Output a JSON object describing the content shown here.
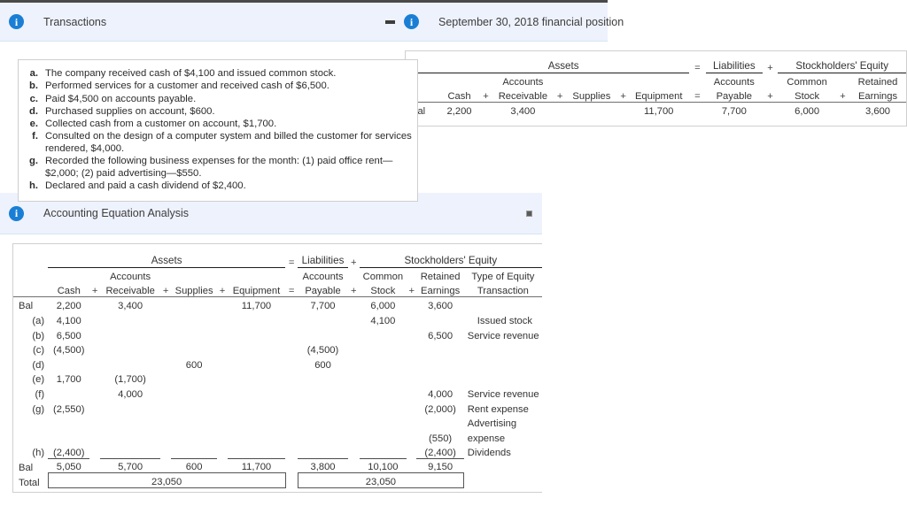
{
  "panels": {
    "transactions": {
      "title": "Transactions",
      "icon": "info-icon",
      "minimize_label": "—",
      "items": [
        {
          "letter": "a.",
          "text": "The company received cash of $4,100 and issued common stock."
        },
        {
          "letter": "b.",
          "text": "Performed services for a customer and received cash of $6,500."
        },
        {
          "letter": "c.",
          "text": "Paid $4,500 on accounts payable."
        },
        {
          "letter": "d.",
          "text": "Purchased supplies on account, $600."
        },
        {
          "letter": "e.",
          "text": "Collected cash from a customer on account, $1,700."
        },
        {
          "letter": "f.",
          "text": "Consulted on the design of a computer system and billed the customer for services rendered, $4,000."
        },
        {
          "letter": "g.",
          "text": "Recorded the following business expenses for the month: (1) paid office rent—$2,000; (2) paid advertising—$550."
        },
        {
          "letter": "h.",
          "text": "Declared and paid a cash dividend of $2,400."
        }
      ]
    },
    "financial_position": {
      "title": "September 30, 2018 financial position",
      "icon": "info-icon",
      "groups": {
        "assets": "Assets",
        "liabilities": "Liabilities",
        "equity": "Stockholders' Equity"
      },
      "operators": {
        "eq": "=",
        "plus": "+"
      },
      "columns": {
        "cash": {
          "line1": "",
          "line2": "Cash"
        },
        "receivable": {
          "line1": "Accounts",
          "line2": "Receivable"
        },
        "supplies": {
          "line1": "",
          "line2": "Supplies"
        },
        "equipment": {
          "line1": "",
          "line2": "Equipment"
        },
        "payable": {
          "line1": "Accounts",
          "line2": "Payable"
        },
        "stock": {
          "line1": "Common",
          "line2": "Stock"
        },
        "earnings": {
          "line1": "Retained",
          "line2": "Earnings"
        }
      },
      "row": {
        "label": "Bal",
        "cash": "2,200",
        "receivable": "3,400",
        "supplies": "",
        "equipment": "11,700",
        "payable": "7,700",
        "stock": "6,000",
        "earnings": "3,600"
      }
    },
    "accounting_equation": {
      "title": "Accounting Equation Analysis",
      "icon": "info-icon",
      "groups": {
        "assets": "Assets",
        "liabilities": "Liabilities",
        "equity": "Stockholders' Equity"
      },
      "operators": {
        "eq": "=",
        "plus": "+"
      },
      "columns": {
        "cash": {
          "line1": "",
          "line2": "Cash"
        },
        "receivable": {
          "line1": "Accounts",
          "line2": "Receivable"
        },
        "supplies": {
          "line1": "",
          "line2": "Supplies"
        },
        "equipment": {
          "line1": "",
          "line2": "Equipment"
        },
        "payable": {
          "line1": "Accounts",
          "line2": "Payable"
        },
        "stock": {
          "line1": "Common",
          "line2": "Stock"
        },
        "earnings": {
          "line1": "Retained",
          "line2": "Earnings"
        },
        "type": {
          "line1": "Type of Equity",
          "line2": "Transaction"
        }
      },
      "rows": [
        {
          "label": "Bal",
          "cash": "2,200",
          "receivable": "3,400",
          "supplies": "",
          "equipment": "11,700",
          "payable": "7,700",
          "stock": "6,000",
          "earnings": "3,600",
          "type": ""
        },
        {
          "label": "(a)",
          "cash": "4,100",
          "receivable": "",
          "supplies": "",
          "equipment": "",
          "payable": "",
          "stock": "4,100",
          "earnings": "",
          "type": "Issued stock"
        },
        {
          "label": "(b)",
          "cash": "6,500",
          "receivable": "",
          "supplies": "",
          "equipment": "",
          "payable": "",
          "stock": "",
          "earnings": "6,500",
          "type": "Service revenue"
        },
        {
          "label": "(c)",
          "cash": "(4,500)",
          "receivable": "",
          "supplies": "",
          "equipment": "",
          "payable": "(4,500)",
          "stock": "",
          "earnings": "",
          "type": ""
        },
        {
          "label": "(d)",
          "cash": "",
          "receivable": "",
          "supplies": "600",
          "equipment": "",
          "payable": "600",
          "stock": "",
          "earnings": "",
          "type": ""
        },
        {
          "label": "(e)",
          "cash": "1,700",
          "receivable": "(1,700)",
          "supplies": "",
          "equipment": "",
          "payable": "",
          "stock": "",
          "earnings": "",
          "type": ""
        },
        {
          "label": "(f)",
          "cash": "",
          "receivable": "4,000",
          "supplies": "",
          "equipment": "",
          "payable": "",
          "stock": "",
          "earnings": "4,000",
          "type": "Service revenue"
        },
        {
          "label": "(g)",
          "cash": "(2,550)",
          "receivable": "",
          "supplies": "",
          "equipment": "",
          "payable": "",
          "stock": "",
          "earnings": "(2,000)",
          "type": "Rent expense"
        },
        {
          "label": "",
          "cash": "",
          "receivable": "",
          "supplies": "",
          "equipment": "",
          "payable": "",
          "stock": "",
          "earnings": "",
          "type": "Advertising"
        },
        {
          "label": "",
          "cash": "",
          "receivable": "",
          "supplies": "",
          "equipment": "",
          "payable": "",
          "stock": "",
          "earnings": "(550)",
          "type": "expense"
        },
        {
          "label": "(h)",
          "cash": "(2,400)",
          "receivable": "",
          "supplies": "",
          "equipment": "",
          "payable": "",
          "stock": "",
          "earnings": "(2,400)",
          "type": "Dividends",
          "ruled": true
        }
      ],
      "balance_row": {
        "label": "Bal",
        "cash": "5,050",
        "receivable": "5,700",
        "supplies": "600",
        "equipment": "11,700",
        "payable": "3,800",
        "stock": "10,100",
        "earnings": "9,150",
        "type": ""
      },
      "total_row": {
        "label": "Total",
        "assets_total": "23,050",
        "equity_total": "23,050"
      }
    }
  }
}
